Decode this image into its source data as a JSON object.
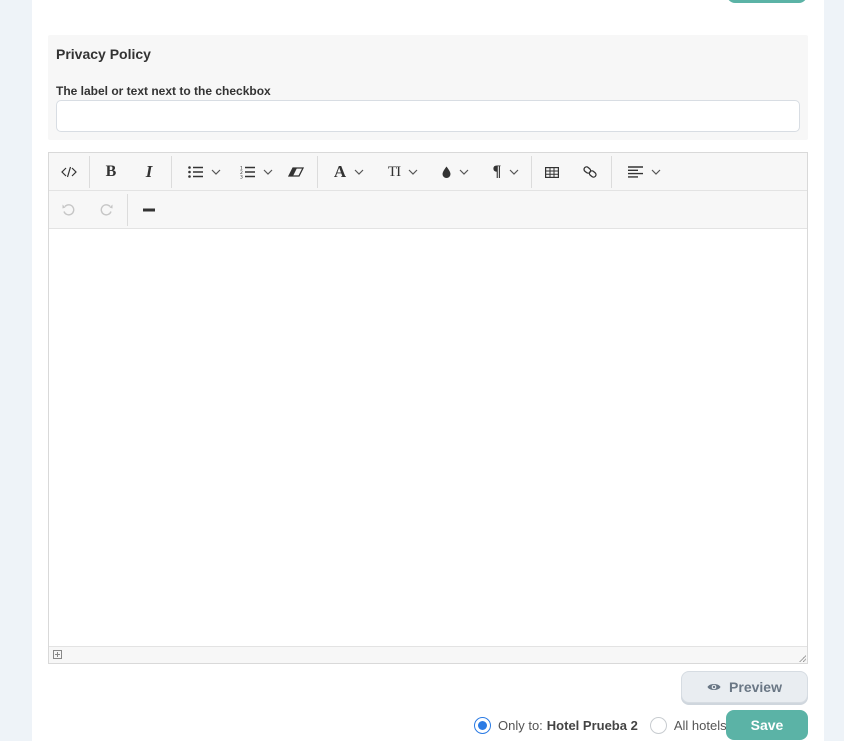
{
  "section": {
    "title": "Privacy Policy",
    "checkbox_label_field": {
      "label": "The label or text next to the checkbox",
      "value": "",
      "placeholder": ""
    }
  },
  "editor": {
    "content": "",
    "toolbar_row1": [
      {
        "name": "code-view",
        "icon": "code-icon"
      },
      {
        "name": "bold",
        "glyph": "B"
      },
      {
        "name": "italic",
        "glyph": "I"
      },
      {
        "name": "unordered-list",
        "icon": "list-icon",
        "dropdown": true
      },
      {
        "name": "ordered-list",
        "icon": "ordered-list-icon",
        "dropdown": true
      },
      {
        "name": "clear-format",
        "icon": "eraser-icon"
      },
      {
        "name": "font-color",
        "glyph": "A",
        "dropdown": true
      },
      {
        "name": "font-size",
        "glyph": "TI",
        "dropdown": true
      },
      {
        "name": "color",
        "icon": "drop-icon",
        "dropdown": true
      },
      {
        "name": "paragraph",
        "glyph": "¶",
        "dropdown": true
      },
      {
        "name": "table",
        "icon": "table-icon"
      },
      {
        "name": "link",
        "icon": "link-icon"
      },
      {
        "name": "align",
        "icon": "align-left-icon",
        "dropdown": true
      }
    ],
    "toolbar_row2": [
      {
        "name": "undo",
        "icon": "undo-icon",
        "disabled": true
      },
      {
        "name": "redo",
        "icon": "redo-icon",
        "disabled": true
      },
      {
        "name": "horizontal-rule",
        "icon": "hr-icon"
      }
    ]
  },
  "actions": {
    "preview_label": "Preview",
    "save_label": "Save"
  },
  "scope": {
    "only_to_label": "Only to:",
    "hotel_name": "Hotel Prueba 2",
    "all_hotels_label": "All hotels",
    "selected": "only_to"
  },
  "colors": {
    "accent": "#5bb3a6",
    "radio_selected": "#2b7be4",
    "page_background": "#eef3f8"
  }
}
